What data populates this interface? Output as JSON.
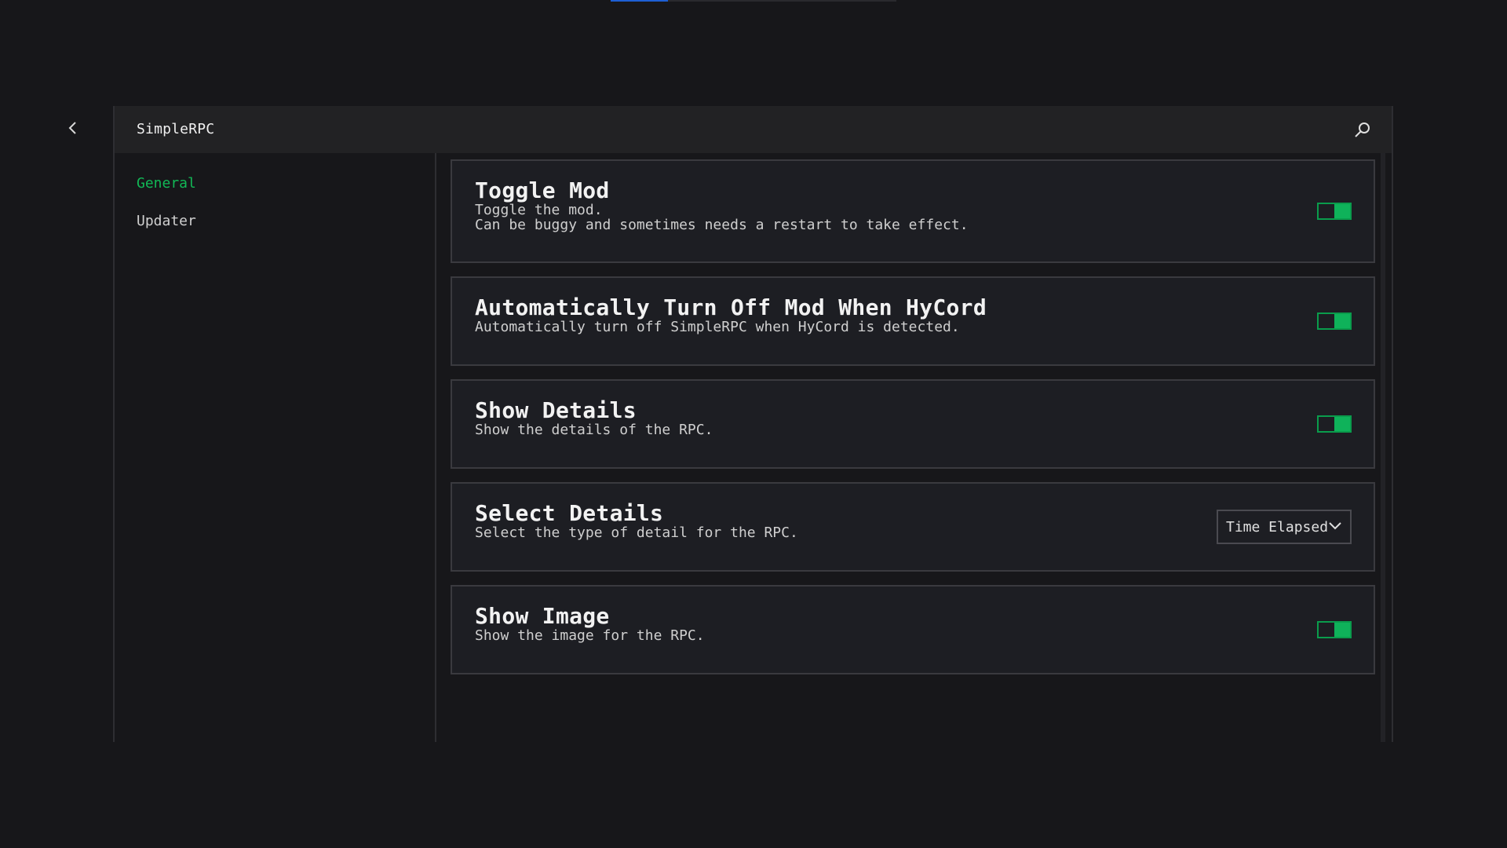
{
  "progress": {
    "fraction": 0.2
  },
  "window": {
    "title": "SimpleRPC"
  },
  "sidebar": {
    "items": [
      {
        "label": "General",
        "active": true
      },
      {
        "label": "Updater",
        "active": false
      }
    ]
  },
  "settings": [
    {
      "title": "Toggle Mod",
      "desc_lines": [
        "Toggle the mod.",
        "Can be buggy and sometimes needs a restart to take effect."
      ],
      "control": "toggle",
      "value": true
    },
    {
      "title": "Automatically Turn Off Mod When HyCord",
      "desc_lines": [
        "Automatically turn off SimpleRPC when HyCord is detected."
      ],
      "control": "toggle",
      "value": true
    },
    {
      "title": "Show Details",
      "desc_lines": [
        "Show the details of the RPC."
      ],
      "control": "toggle",
      "value": true
    },
    {
      "title": "Select Details",
      "desc_lines": [
        "Select the type of detail for the RPC."
      ],
      "control": "dropdown",
      "value": "Time Elapsed"
    },
    {
      "title": "Show Image",
      "desc_lines": [
        "Show the image for the RPC."
      ],
      "control": "toggle",
      "value": true
    }
  ],
  "icons": {
    "back": "chevron-left-icon",
    "search": "search-icon",
    "dropdown": "chevron-down-icon"
  },
  "colors": {
    "accent": "#0fb25a",
    "active_nav": "#12b856",
    "progress": "#1e5fd4",
    "background": "#17171a",
    "card": "#1d1e23"
  }
}
